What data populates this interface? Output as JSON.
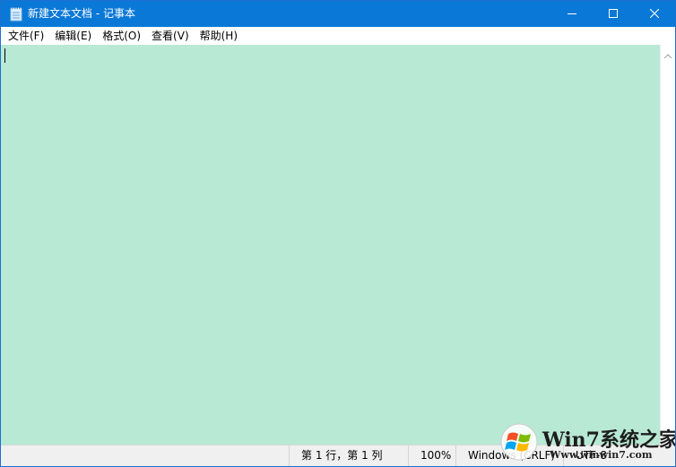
{
  "window": {
    "title": "新建文本文档 - 记事本",
    "app_icon": "notepad-icon",
    "controls": [
      "minimize-icon",
      "maximize-icon",
      "close-icon"
    ]
  },
  "menu": {
    "items": [
      {
        "label": "文件(F)"
      },
      {
        "label": "编辑(E)"
      },
      {
        "label": "格式(O)"
      },
      {
        "label": "查看(V)"
      },
      {
        "label": "帮助(H)"
      }
    ]
  },
  "editor": {
    "content": "",
    "background_color": "#b8e9d4"
  },
  "status": {
    "position": "第 1 行，第 1 列",
    "zoom": "100%",
    "line_ending": "Windows (CRLF)",
    "encoding": "UTF-8"
  },
  "watermark": {
    "logo_text": "Win7系统之家",
    "url": "Www.winwin7.com"
  },
  "colors": {
    "titlebar": "#0a78d7",
    "editor_bg": "#b8e9d4"
  }
}
